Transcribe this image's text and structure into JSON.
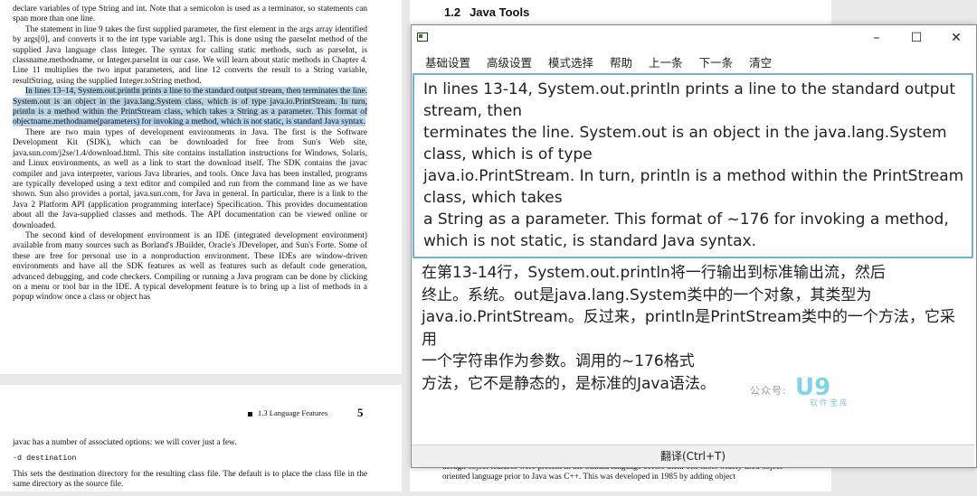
{
  "left_page": {
    "paragraphs": [
      {
        "id": "p1",
        "indent": false,
        "highlight": false,
        "text": "declare variables of type String and int. Note that a semicolon is used as a terminator, so statements can span more than one line."
      },
      {
        "id": "p2",
        "indent": true,
        "highlight": false,
        "text": "The statement in line 9 takes the first supplied parameter, the first element in the args array identified by args[0], and converts it to the int type variable arg1. This is done using the parseInt method of the supplied Java language class Integer. The syntax for calling static methods, such as parseInt, is classname.methodname, or Integer.parseInt in our case. We will learn about static methods in Chapter 4. Line 11 multiplies the two input parameters, and line 12 converts the result to a String variable, resultString, using the supplied Integer.toString method."
      },
      {
        "id": "p3",
        "indent": true,
        "highlight": true,
        "text": "In lines 13–14, System.out.println prints a line to the standard output stream, then terminates the line. System.out is an object in the java.lang.System class, which is of type java.io.PrintStream. In turn, println is a method within the PrintStream class, which takes a String as a parameter. This format of objectname.methodname(parameters) for invoking a method, which is not static, is standard Java syntax."
      },
      {
        "id": "p4",
        "indent": true,
        "highlight": false,
        "text": "There are two main types of development environments in Java. The first is the Software Development Kit (SDK), which can be downloaded for free from Sun's Web site, java.sun.com/j2se/1.4/download.html. This site contains installation instructions for Windows, Solaris, and Linux environments, as well as a link to start the download itself. The SDK contains the javac compiler and java interpreter, various Java libraries, and tools. Once Java has been installed, programs are typically developed using a text editor and compiled and run from the command line as we have shown. Sun also provides a portal, java.sun.com, for Java in general. In particular, there is a link to the Java 2 Platform API (application programming interface) Specification. This provides documentation about all the Java-supplied classes and methods. The API documentation can be viewed online or downloaded."
      },
      {
        "id": "p5",
        "indent": true,
        "highlight": false,
        "text": "The second kind of development environment is an IDE (integrated development environment) available from many sources such as Borland's JBuilder, Oracle's JDeveloper, and Sun's Forte. Some of these are free for personal use in a nonproduction environment. These IDEs are window-driven environments and have all the SDK features as well as features such as default code generation, advanced debugging, and code checkers. Compiling or running a Java program can be done by clicking on a menu or tool bar in the IDE. A typical development feature is to bring up a list of methods in a popup window once a class or object has"
      }
    ],
    "next_header": "1.3 Language Features",
    "page_number": "5",
    "bottom_lines": [
      "javac has a number of associated options: we will cover just a few.",
      "-d destination",
      "This sets the destination directory for the resulting class file. The default is to place the class file in the same directory as the source file."
    ]
  },
  "right_page": {
    "heading_number": "1.2",
    "heading_title": "Java Tools",
    "bottom_lines": "though object features were present in the Simula language before then. The most widely used object-oriented language prior to Java was C++. This was developed in 1985 by adding object"
  },
  "window": {
    "controls": {
      "minimize": "–",
      "maximize": "☐",
      "close": "✕"
    },
    "menu": [
      "基础设置",
      "高级设置",
      "模式选择",
      "帮助",
      "上一条",
      "下一条",
      "清空"
    ],
    "source_text": "In lines 13-14, System.out.println prints a line to the standard output stream, then\nterminates the line. System.out is an object in the java.lang.System class, which is of type\njava.io.PrintStream. In turn, println is a method within the PrintStream class, which takes\na String as a parameter. This format of ~176 for invoking a method, which is not static, is standard Java syntax.",
    "target_text": "在第13-14行，System.out.println将一行输出到标准输出流，然后\n终止。系统。out是java.lang.System类中的一个对象，其类型为\njava.io.PrintStream。反过来，println是PrintStream类中的一个方法，它采用\n一个字符串作为参数。调用的~176格式\n方法，它不是静态的，是标准的Java语法。",
    "watermark": {
      "prefix": "公众号:",
      "logo": "U9",
      "sub": "软件宝库"
    },
    "footer_button": "翻译(Ctrl+T)",
    "accent_color": "#6eb2d6"
  }
}
